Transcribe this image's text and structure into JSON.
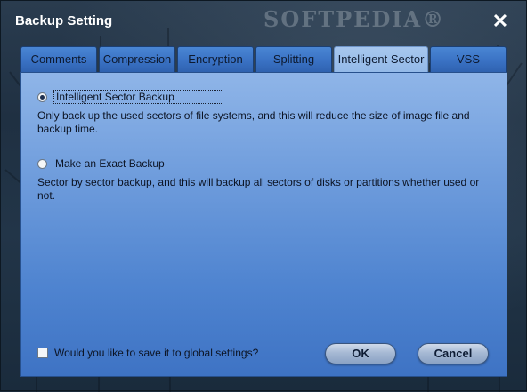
{
  "window": {
    "title": "Backup Setting",
    "close_glyph": "✕",
    "watermark": "SOFTPEDIA®"
  },
  "tabs": [
    {
      "label": "Comments",
      "active": false
    },
    {
      "label": "Compression",
      "active": false
    },
    {
      "label": "Encryption",
      "active": false
    },
    {
      "label": "Splitting",
      "active": false
    },
    {
      "label": "Intelligent Sector",
      "active": true
    },
    {
      "label": "VSS",
      "active": false
    }
  ],
  "options": {
    "intelligent": {
      "label": "Intelligent Sector Backup",
      "checked": true,
      "description": "Only back up the used sectors of file systems, and this will reduce the size of image file and backup time."
    },
    "exact": {
      "label": "Make an Exact Backup",
      "checked": false,
      "description": "Sector by sector backup, and this will backup all sectors of disks or partitions whether used or not."
    }
  },
  "footer": {
    "save_global_label": "Would you like to save it to global settings?",
    "save_global_checked": false,
    "ok_label": "OK",
    "cancel_label": "Cancel"
  }
}
